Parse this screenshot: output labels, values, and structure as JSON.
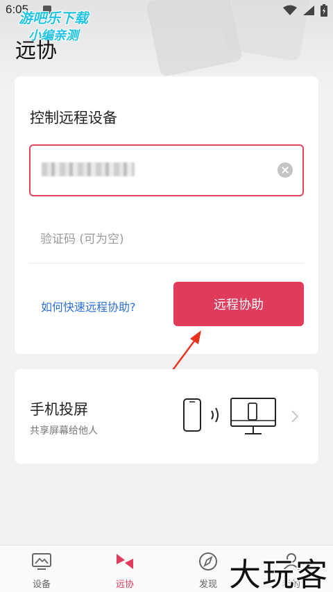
{
  "status_bar": {
    "time": "6:05"
  },
  "watermark_top": {
    "line1": "游吧乐下载",
    "line2": "小编亲测"
  },
  "page": {
    "title": "远协"
  },
  "remote_card": {
    "title": "控制远程设备",
    "device_id_value": "",
    "code_placeholder": "验证码 (可为空)",
    "help_link": "如何快速远程协助?",
    "button_label": "远程协助"
  },
  "cast_card": {
    "title": "手机投屏",
    "subtitle": "共享屏幕给他人"
  },
  "bottom_nav": {
    "items": [
      {
        "label": "设备",
        "icon": "device-icon",
        "active": false
      },
      {
        "label": "远协",
        "icon": "remote-icon",
        "active": true
      },
      {
        "label": "发现",
        "icon": "compass-icon",
        "active": false
      },
      {
        "label": "我的",
        "icon": "profile-icon",
        "active": false
      }
    ]
  },
  "watermark_bottom": "大玩客",
  "colors": {
    "accent": "#e03b5b",
    "link": "#2b6fd6",
    "background": "#f2f2f2"
  }
}
